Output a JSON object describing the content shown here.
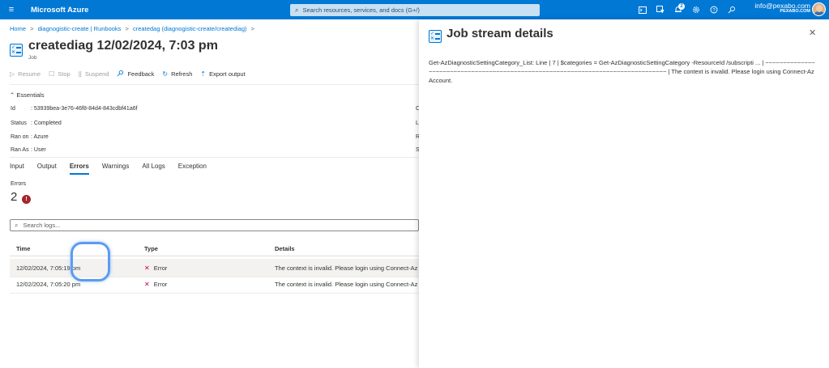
{
  "topbar": {
    "menu_icon": "≡",
    "brand": "Microsoft Azure",
    "search_placeholder": "Search resources, services, and docs (G+/)",
    "notification_count": "2",
    "user_email": "info@pexabo.com",
    "user_org": "PEXABO.COM",
    "icons": [
      "cloud-shell-icon",
      "directory-filter-icon",
      "notifications-icon",
      "settings-icon",
      "help-icon",
      "feedback-icon"
    ],
    "accent": "#0078d4"
  },
  "breadcrumb": {
    "items": [
      "Home",
      "diagnogistic-create | Runbooks",
      "createdag (diagnogistic-create/creatediag)"
    ],
    "separator": ">"
  },
  "header": {
    "title": "creatediag 12/02/2024, 7:03 pm",
    "more": "···",
    "subtitle": "Job"
  },
  "toolbar": {
    "resume": "Resume",
    "stop": "Stop",
    "suspend": "Suspend",
    "feedback": "Feedback",
    "refresh": "Refresh",
    "export": "Export output"
  },
  "essentials": {
    "toggle_label": "Essentials",
    "rows": [
      {
        "key": "Id",
        "value": ": 53939bea-3e76-46f8-84d4-843cdbf41a6f"
      },
      {
        "key": "Status",
        "value": ": Completed"
      },
      {
        "key": "Ran on",
        "value": ": Azure"
      },
      {
        "key": "Ran As",
        "value": ": User"
      }
    ],
    "right_col_truncated": [
      "C",
      "L",
      "R",
      "S"
    ]
  },
  "tabs": [
    "Input",
    "Output",
    "Errors",
    "Warnings",
    "All Logs",
    "Exception"
  ],
  "active_tab": "Errors",
  "errors": {
    "label": "Errors",
    "count": "2",
    "badge": "!"
  },
  "search_logs": {
    "placeholder": "Search logs..."
  },
  "table": {
    "headers": [
      "Time",
      "Type",
      "Details"
    ],
    "rows": [
      {
        "time": "12/02/2024, 7:05:19 pm",
        "type": "Error",
        "details": "The context is invalid. Please login using Connect-Az"
      },
      {
        "time": "12/02/2024, 7:05:20 pm",
        "type": "Error",
        "details": "The context is invalid. Please login using Connect-Az"
      }
    ],
    "error_color": "#c30052"
  },
  "panel": {
    "title": "Job stream details",
    "close": "✕",
    "text": "Get-AzDiagnosticSettingCategory_List: Line | 7 | $categories = Get-AzDiagnosticSettingCategory -ResourceId /subscripti ... | ~~~~~~~~~~~~~~~~~~~~~~~~~~~~~~~~~~~~~~~~~~~~~~~~~~~~~~~~~~~~~~~~~~~~~~~~~~~~~~~~~ | The context is invalid. Please login using Connect-AzAccount."
  }
}
